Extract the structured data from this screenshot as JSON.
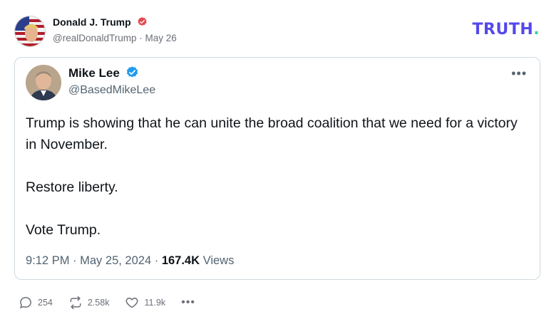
{
  "post": {
    "author_name": "Donald J. Trump",
    "author_handle": "@realDonaldTrump",
    "separator": "·",
    "date": "May 26",
    "brand": {
      "text": "TRUTH",
      "dot": ".",
      "color": "#5448ee",
      "dot_color": "#34d399"
    }
  },
  "quoted": {
    "name": "Mike Lee",
    "handle": "@BasedMikeLee",
    "more": "•••",
    "paragraphs": [
      "Trump is showing that he can unite the broad coalition that we need for a victory in November.",
      "Restore liberty.",
      "Vote Trump."
    ],
    "time": "9:12 PM",
    "dot": "·",
    "date": "May 25, 2024",
    "dot2": "·",
    "views": "167.4K",
    "views_label": "Views"
  },
  "actions": {
    "replies": "254",
    "retruths": "2.58k",
    "likes": "11.9k",
    "more": "•••"
  }
}
